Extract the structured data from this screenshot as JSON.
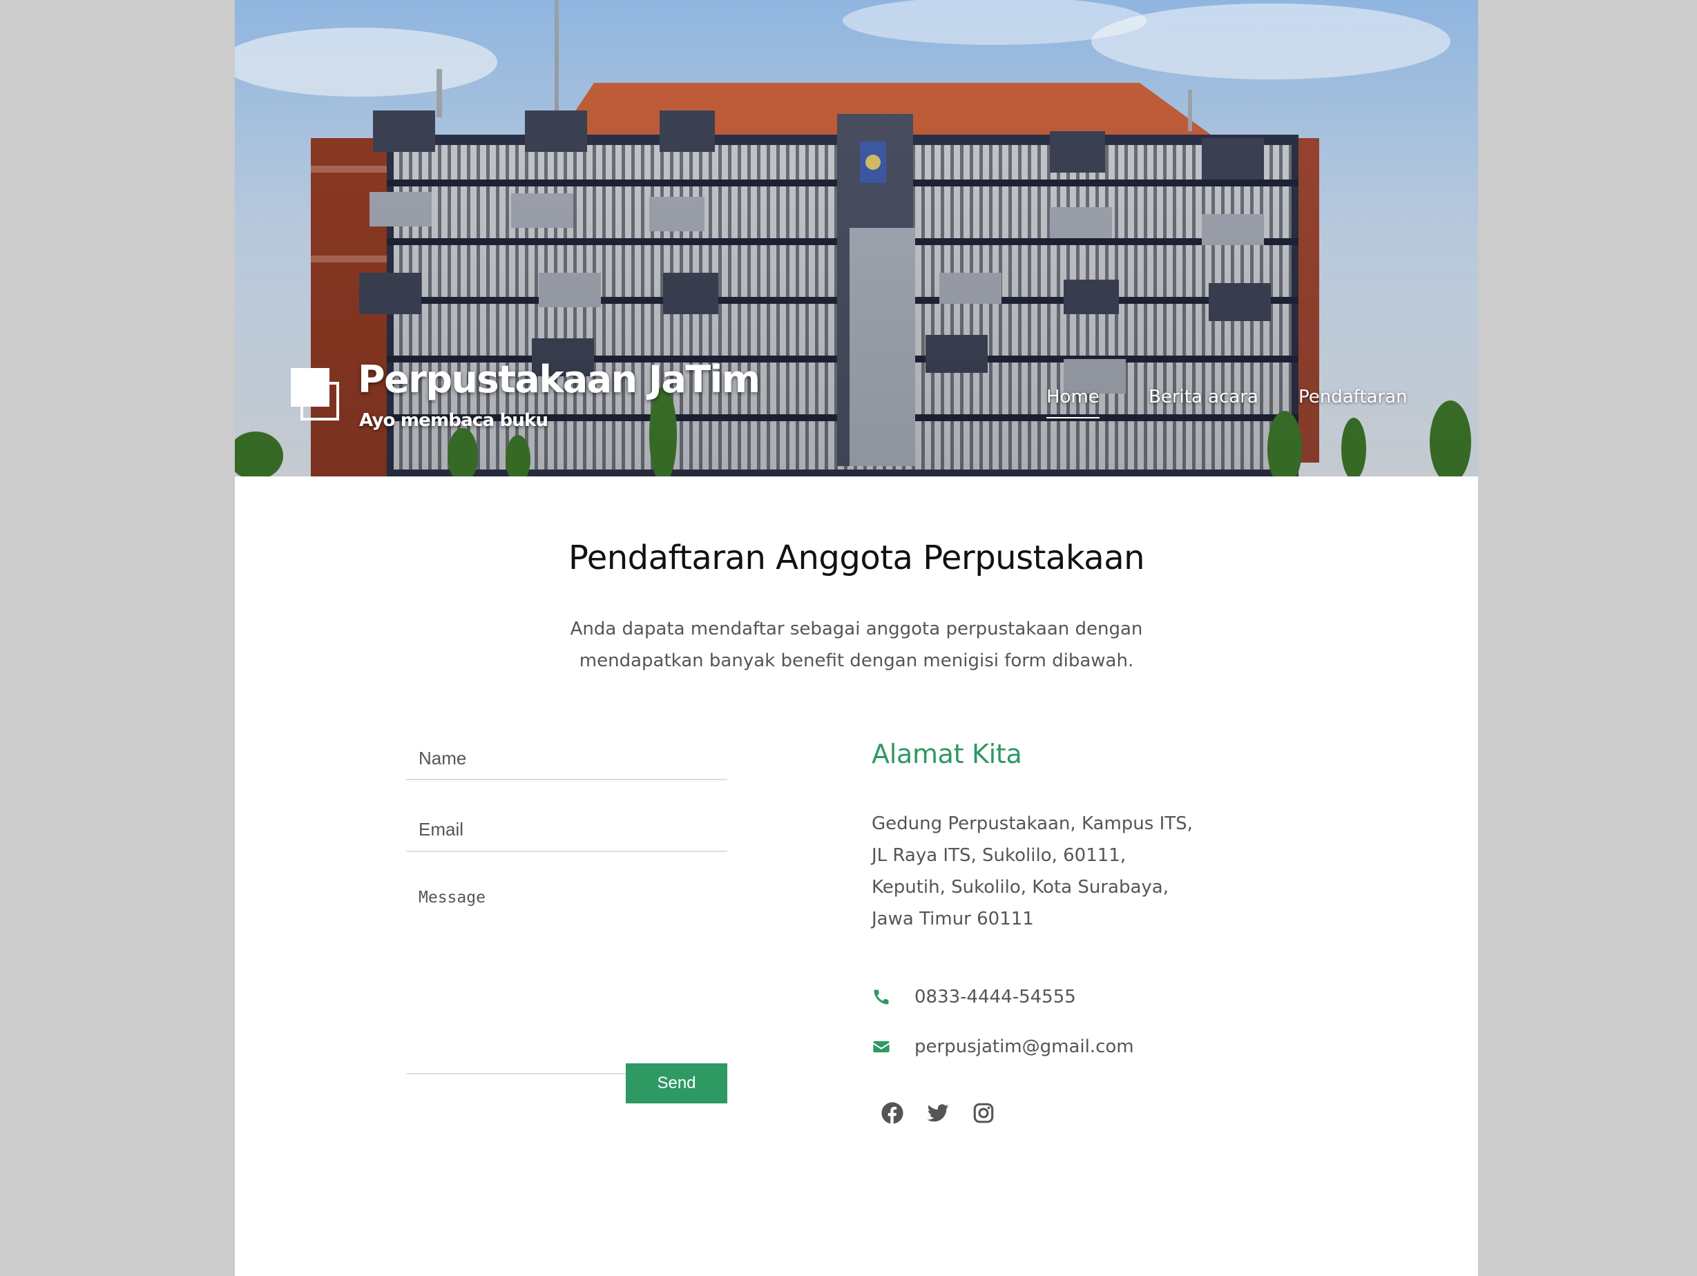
{
  "header": {
    "site_title": "Perpustakaan JaTim",
    "tagline": "Ayo membaca buku",
    "nav": [
      {
        "label": "Home",
        "active": true
      },
      {
        "label": "Berita acara",
        "active": false
      },
      {
        "label": "Pendaftaran",
        "active": false
      }
    ]
  },
  "main": {
    "title": "Pendaftaran Anggota Perpustakaan",
    "intro": "Anda dapata mendaftar sebagai anggota perpustakaan dengan mendapatkan banyak benefit dengan menigisi form dibawah."
  },
  "form": {
    "name_placeholder": "Name",
    "email_placeholder": "Email",
    "message_placeholder": "Message",
    "send_label": "Send"
  },
  "contact": {
    "title": "Alamat Kita",
    "address": "Gedung Perpustakaan, Kampus ITS, JL Raya ITS, Sukolilo, 60111, Keputih, Sukolilo, Kota Surabaya, Jawa Timur 60111",
    "phone": "0833-4444-54555",
    "email": "perpusjatim@gmail.com",
    "social": [
      "facebook-icon",
      "twitter-icon",
      "instagram-icon"
    ]
  },
  "colors": {
    "accent": "#2e9963",
    "background": "#cccccc",
    "text": "#555555"
  }
}
